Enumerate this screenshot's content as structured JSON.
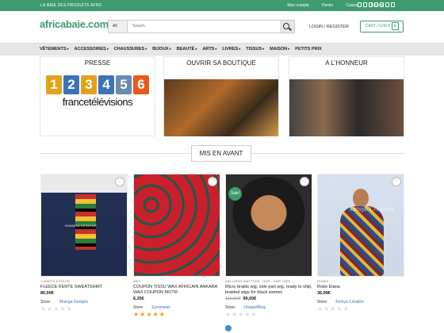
{
  "topbar": {
    "tagline": "LA BAIE DES PRODUITS AFRO",
    "links": [
      "Mon compte",
      "Panier",
      "Caisse",
      "Favoris"
    ]
  },
  "header": {
    "logo": "africabaie.com",
    "logo_sub": "",
    "search_category": "All",
    "search_placeholder": "Search",
    "login": "LOGIN / REGISTER",
    "cart": "CART / 0,00 €",
    "cart_count": "0"
  },
  "nav": [
    "VÊTEMENTS",
    "ACCESSOIRES",
    "CHAUSSURES",
    "BIJOUX",
    "BEAUTÉ",
    "ARTS",
    "LIVRES",
    "TISSUS",
    "MAISON",
    "PETITS PRIX"
  ],
  "sections": {
    "press": {
      "title": "PRESSE",
      "numbers": [
        "1",
        "2",
        "3",
        "4",
        "5",
        "6"
      ],
      "brand": "francetélévisions"
    },
    "shop": {
      "title": "OUVRIR SA BOUTIQUE"
    },
    "honor": {
      "title": "A L'HONNEUR"
    }
  },
  "featured_title": "MIS EN AVANT",
  "products": [
    {
      "category": "T-SHIRTS & POLOS",
      "name": "FLEECE KENTE SWEATSHIRT",
      "old_price": "",
      "price": "80,00€",
      "store_label": "Store:",
      "store": "Shanga Designs",
      "rated": false,
      "sale": "",
      "image_text": "SHANGA DESIGNS"
    },
    {
      "category": "WAX",
      "name": "COUPON TISSU WAX AFRICAIN ANKARA WAX COUPON MOTIF",
      "old_price": "",
      "price": "6,25€",
      "store_label": "Store:",
      "store": "Eyramwax",
      "rated": true,
      "sale": "",
      "image_text": ""
    },
    {
      "category": "WELLNESS AND FOOD - HAIR - HAIR CARE -...",
      "name": "Micro braids wig, side part wig, ready to ship, braided wigs for black women",
      "old_price": "110,00€",
      "price": "99,00€",
      "store_label": "Store:",
      "store": "UniqueMkay",
      "rated": false,
      "sale": "Sale!",
      "image_text": ""
    },
    {
      "category": "ROBES",
      "name": "Robe Elana",
      "old_price": "",
      "price": "36,99€",
      "store_label": "Store:",
      "store": "Ketsya Création",
      "rated": false,
      "sale": "",
      "image_text": "ketsya Creation"
    }
  ],
  "colors": {
    "accent": "#3e9b6d",
    "link": "#3a6fb7",
    "star": "#f39c12"
  },
  "icons": [
    "search-icon",
    "heart-icon",
    "star-icon",
    "facebook-icon",
    "instagram-icon",
    "twitter-icon",
    "email-icon",
    "pinterest-icon",
    "linkedin-icon",
    "youtube-icon"
  ]
}
